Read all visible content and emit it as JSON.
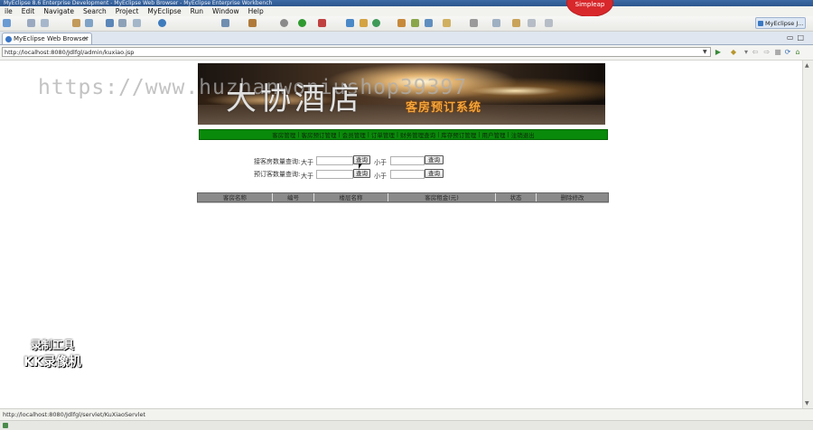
{
  "window": {
    "title": "MyEclipse 8.6 Enterprise Development - MyEclipse Web Browser - MyEclipse Enterprise Workbench"
  },
  "menu": [
    "ile",
    "Edit",
    "Navigate",
    "Search",
    "Project",
    "MyEclipse",
    "Run",
    "Window",
    "Help"
  ],
  "badge": {
    "label": "Simpleap"
  },
  "perspective": {
    "label": "MyEclipse J..."
  },
  "tab": {
    "label": "MyEclipse Web Browser"
  },
  "address": {
    "url": "http://localhost:8080/Jdlfgl/admin/kuxiao.jsp"
  },
  "banner": {
    "tagline": "客房预订系统"
  },
  "nav": [
    "客房管理",
    "客房预订管理",
    "会员管理",
    "订单管理",
    "财务管理查询",
    "库存预订管理",
    "用户管理",
    "注销退出"
  ],
  "search": {
    "row1_label": "接客房数量查询:",
    "row2_label": "预订客数量查询:",
    "gt": "大于",
    "lt": "小于",
    "btn1_label": "查询",
    "btn2_label": "查询",
    "btn3_label": "查询",
    "btn4_label": "查询"
  },
  "table": {
    "headers": [
      "客房名称",
      "编号",
      "楼层名称",
      "客房租金(元)",
      "状态",
      "删除修改"
    ]
  },
  "overlays": {
    "watermark": "https://www.huzhanwoniushop39397",
    "watermark_cn": "大协酒店",
    "recorder_line1": "录制工具",
    "recorder_line2": "KK录像机"
  },
  "status": {
    "text": "http://localhost:8080/Jdlfgl/servlet/KuXiaoServlet"
  }
}
